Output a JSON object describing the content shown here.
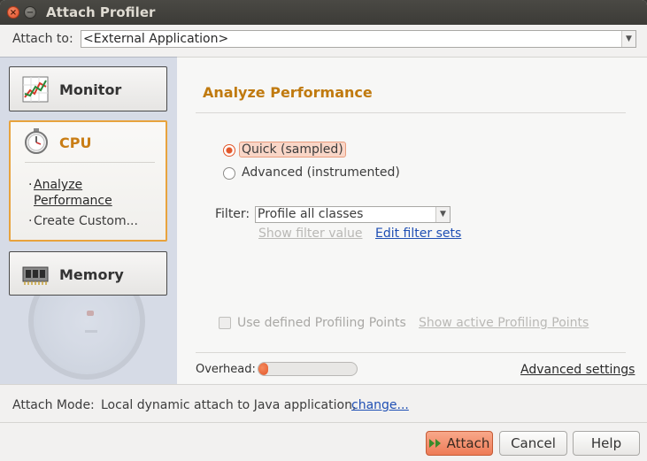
{
  "window": {
    "title": "Attach Profiler"
  },
  "attach_to": {
    "label": "Attach to:",
    "value": "<External Application>"
  },
  "sidebar": {
    "monitor": {
      "label": "Monitor"
    },
    "cpu": {
      "label": "CPU",
      "items": [
        {
          "label_line1": "Analyze",
          "label_line2": "Performance"
        },
        {
          "label": "Create Custom..."
        }
      ]
    },
    "memory": {
      "label": "Memory"
    }
  },
  "main": {
    "heading": "Analyze Performance",
    "modes": [
      {
        "label": "Quick (sampled)",
        "checked": true
      },
      {
        "label": "Advanced (instrumented)",
        "checked": false
      }
    ],
    "filter": {
      "label": "Filter:",
      "value": "Profile all classes",
      "show_filter_value": "Show filter value",
      "edit_filter_sets": "Edit filter sets"
    },
    "profiling_points": {
      "checkbox_label": "Use defined Profiling Points",
      "show_link": "Show active Profiling Points"
    },
    "overhead": {
      "label": "Overhead:",
      "level": 0.08
    },
    "advanced_settings": "Advanced settings"
  },
  "attach_mode": {
    "label": "Attach Mode:",
    "value": "Local dynamic attach to Java application,",
    "change_link": "change..."
  },
  "buttons": {
    "attach": "Attach",
    "cancel": "Cancel",
    "help": "Help"
  },
  "colors": {
    "accent": "#e2572a",
    "heading": "#c07a0f",
    "link": "#1f4fb4"
  }
}
